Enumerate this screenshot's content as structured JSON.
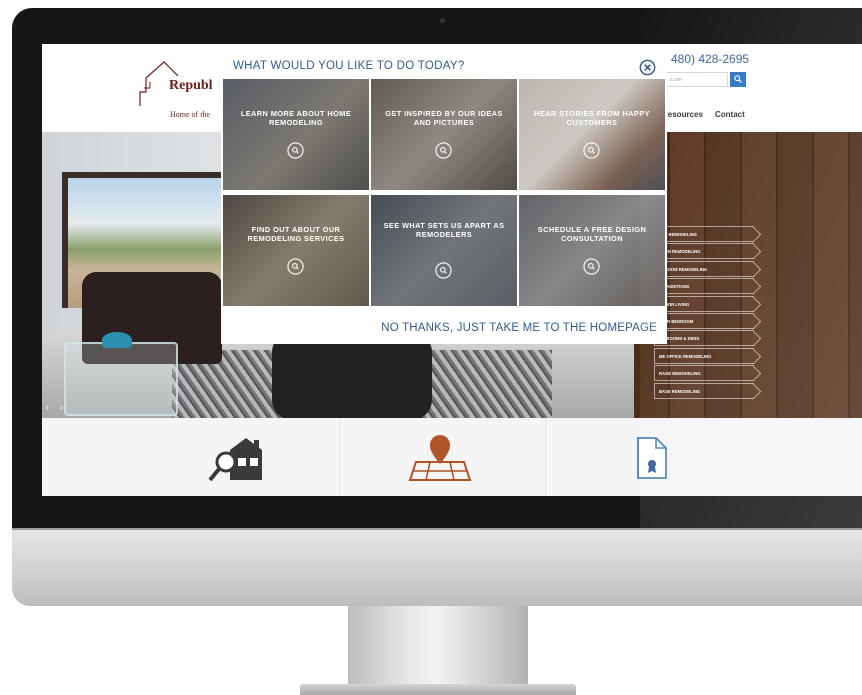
{
  "site": {
    "logo_text": "Republ",
    "tagline": "Home of the",
    "phone": "480) 428-2695",
    "search_placeholder": "a site",
    "nav": {
      "resources": "Resources",
      "contact": "Contact"
    }
  },
  "services_menu": [
    "ENT REMODELING",
    "CHEN REMODELING",
    "THROOM REMODELING",
    "ME ADDITIONS",
    "TDOOR LIVING",
    "STER BEDROOM",
    "NG ROOMS & DENS",
    "ME OFFICE REMODELING",
    "RAGE REMODELING",
    "BASE REMODELING"
  ],
  "modal": {
    "title": "WHAT WOULD YOU LIKE TO DO TODAY?",
    "footer_link": "NO THANKS, JUST TAKE ME TO THE HOMEPAGE",
    "tiles": [
      {
        "label": "LEARN MORE ABOUT HOME REMODELING",
        "icon": "magnifier-icon"
      },
      {
        "label": "GET INSPIRED BY OUR IDEAS AND PICTURES",
        "icon": "magnifier-icon"
      },
      {
        "label": "HEAR STORIES FROM HAPPY CUSTOMERS",
        "icon": "magnifier-icon"
      },
      {
        "label": "FIND OUT ABOUT OUR REMODELING SERVICES",
        "icon": "magnifier-icon"
      },
      {
        "label": "SEE WHAT SETS US APART AS REMODELERS",
        "icon": "magnifier-icon"
      },
      {
        "label": "SCHEDULE A FREE DESIGN CONSULTATION",
        "icon": "magnifier-icon"
      }
    ]
  },
  "colors": {
    "brand_blue": "#2f5d93",
    "logo_red": "#6b1e1e",
    "accent_orange": "#b0542a"
  }
}
